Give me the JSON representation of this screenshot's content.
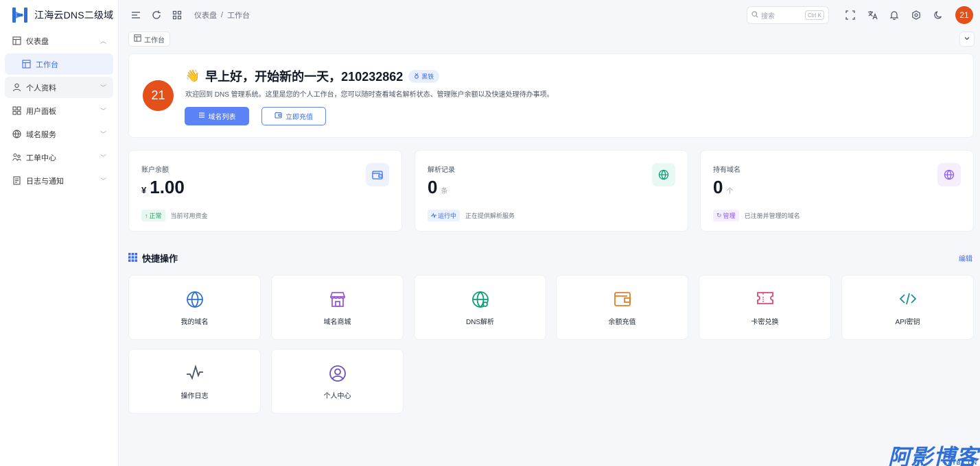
{
  "sidebar": {
    "brand": "江海云DNS二级域",
    "items": [
      {
        "label": "仪表盘"
      },
      {
        "label": "工作台"
      },
      {
        "label": "个人资料"
      },
      {
        "label": "用户面板"
      },
      {
        "label": "域名服务"
      },
      {
        "label": "工单中心"
      },
      {
        "label": "日志与通知"
      }
    ]
  },
  "header": {
    "breadcrumb": [
      "仪表盘",
      "/",
      "工作台"
    ],
    "search_placeholder": "搜索",
    "search_shortcut": "Ctrl K",
    "avatar_text": "21"
  },
  "tabs": [
    {
      "label": "工作台"
    }
  ],
  "welcome": {
    "avatar_text": "21",
    "greeting": "早上好，开始新的一天，210232862",
    "level_badge": "黑铁",
    "description": "欢迎回到 DNS 管理系统。这里是您的个人工作台，您可以随时查看域名解析状态、管理账户余额以及快速处理待办事项。",
    "btn_primary": "域名列表",
    "btn_secondary": "立即充值"
  },
  "stats": [
    {
      "label": "账户余额",
      "currency": "¥",
      "value": "1.00",
      "unit": "",
      "chip": "正常",
      "note": "当前可用资金",
      "color": "#3b6cf6"
    },
    {
      "label": "解析记录",
      "currency": "",
      "value": "0",
      "unit": "条",
      "chip": "运行中",
      "note": "正在提供解析服务",
      "color": "#10b981"
    },
    {
      "label": "持有域名",
      "currency": "",
      "value": "0",
      "unit": "个",
      "chip": "管理",
      "note": "已注册并管理的域名",
      "color": "#8b5cf6"
    }
  ],
  "quick": {
    "title": "快捷操作",
    "edit": "编辑",
    "items": [
      {
        "label": "我的域名",
        "icon": "globe-icon",
        "color": "#2f6fd6"
      },
      {
        "label": "域名商城",
        "icon": "store-icon",
        "color": "#9b59d0"
      },
      {
        "label": "DNS解析",
        "icon": "dns-globe-icon",
        "color": "#0f9d77"
      },
      {
        "label": "余额充值",
        "icon": "wallet-icon",
        "color": "#e67e22"
      },
      {
        "label": "卡密兑换",
        "icon": "ticket-icon",
        "color": "#e0457b"
      },
      {
        "label": "API密钥",
        "icon": "code-icon",
        "color": "#1a8fa8"
      },
      {
        "label": "操作日志",
        "icon": "pulse-icon",
        "color": "#4b5563"
      },
      {
        "label": "个人中心",
        "icon": "user-circle-icon",
        "color": "#6d4fc2"
      }
    ]
  },
  "watermark": {
    "main": "阿影博客",
    "sub": "AYBK.CN"
  }
}
